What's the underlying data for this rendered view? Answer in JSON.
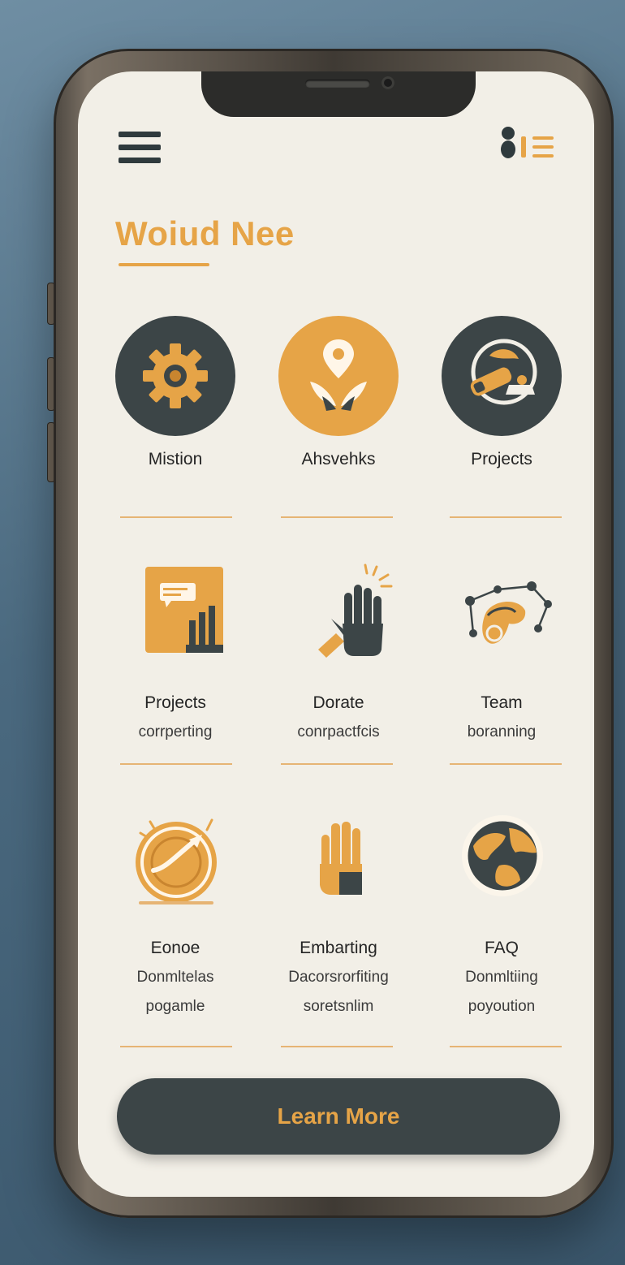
{
  "header": {
    "title": "Woiud Nee",
    "menu_icon": "hamburger-menu-icon",
    "profile_icon": "profile-list-icon"
  },
  "grid": [
    {
      "label": "Mistion",
      "sub": "",
      "sub2": "",
      "icon": "gear-icon"
    },
    {
      "label": "Ahsvehks",
      "sub": "",
      "sub2": "",
      "icon": "location-pin-icon"
    },
    {
      "label": "Projects",
      "sub": "",
      "sub2": "",
      "icon": "tools-icon"
    },
    {
      "label": "Projects",
      "sub": "corrperting",
      "sub2": "",
      "icon": "document-chart-icon"
    },
    {
      "label": "Dorate",
      "sub": "conrpactfcis",
      "sub2": "",
      "icon": "raised-hand-icon"
    },
    {
      "label": "Team",
      "sub": "boranning",
      "sub2": "",
      "icon": "network-team-icon"
    },
    {
      "label": "Eonoe",
      "sub": "Donmltelas",
      "sub2": "pogamle",
      "icon": "target-arrow-icon"
    },
    {
      "label": "Embarting",
      "sub": "Dacorsrorfiting",
      "sub2": "soretsnlim",
      "icon": "hand-icon"
    },
    {
      "label": "FAQ",
      "sub": "Donmltiing",
      "sub2": "poyoution",
      "icon": "globe-icon"
    }
  ],
  "cta": {
    "label": "Learn More"
  },
  "colors": {
    "accent": "#e6a447",
    "dark": "#3c4547",
    "screen_bg": "#f2efe7",
    "backdrop": "#4b6a80"
  }
}
